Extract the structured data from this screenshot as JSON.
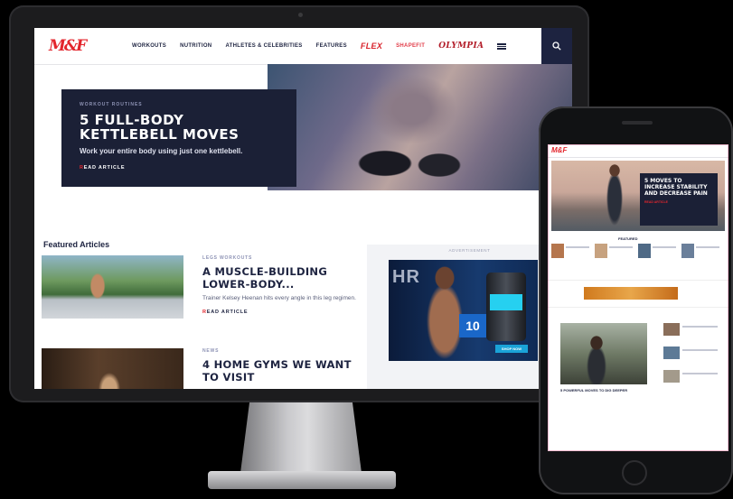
{
  "desktop": {
    "logo": "M&F",
    "nav": [
      {
        "label": "WORKOUTS",
        "class": ""
      },
      {
        "label": "NUTRITION",
        "class": ""
      },
      {
        "label": "ATHLETES & CELEBRITIES",
        "class": ""
      },
      {
        "label": "FEATURES",
        "class": ""
      }
    ],
    "brands": {
      "flex": "FLEX",
      "shapefit": "SHAPEFIT",
      "olympia": "OLYMPIA"
    },
    "hero": {
      "kicker": "WORKOUT ROUTINES",
      "title": "5 FULL-BODY KETTLEBELL MOVES",
      "subtitle": "Work your entire body using just one kettlebell.",
      "link_prefix": "R",
      "link_rest": "EAD ARTICLE"
    },
    "featured_label": "Featured Articles",
    "articles": [
      {
        "kicker": "LEGS WORKOUTS",
        "title": "A MUSCLE-BUILDING LOWER-BODY...",
        "subtitle": "Trainer Kelsey Heenan hits every angle in this leg regimen.",
        "link_prefix": "R",
        "link_rest": "EAD ARTICLE"
      },
      {
        "kicker": "NEWS",
        "title": "4 HOME GYMS WE WANT TO VISIT"
      }
    ],
    "ad": {
      "label": "ADVERTISEMENT",
      "headline": "HR",
      "badge": "10",
      "cta": "SHOP NOW"
    }
  },
  "mobile": {
    "logo": "M&F",
    "hero_title": "5 MOVES TO INCREASE STABILITY AND DECREASE PAIN",
    "hero_link": "READ ARTICLE",
    "section_label": "FEATURED",
    "feature_caption": "5 POWERFUL MOVES TO DIG DEEPER"
  }
}
